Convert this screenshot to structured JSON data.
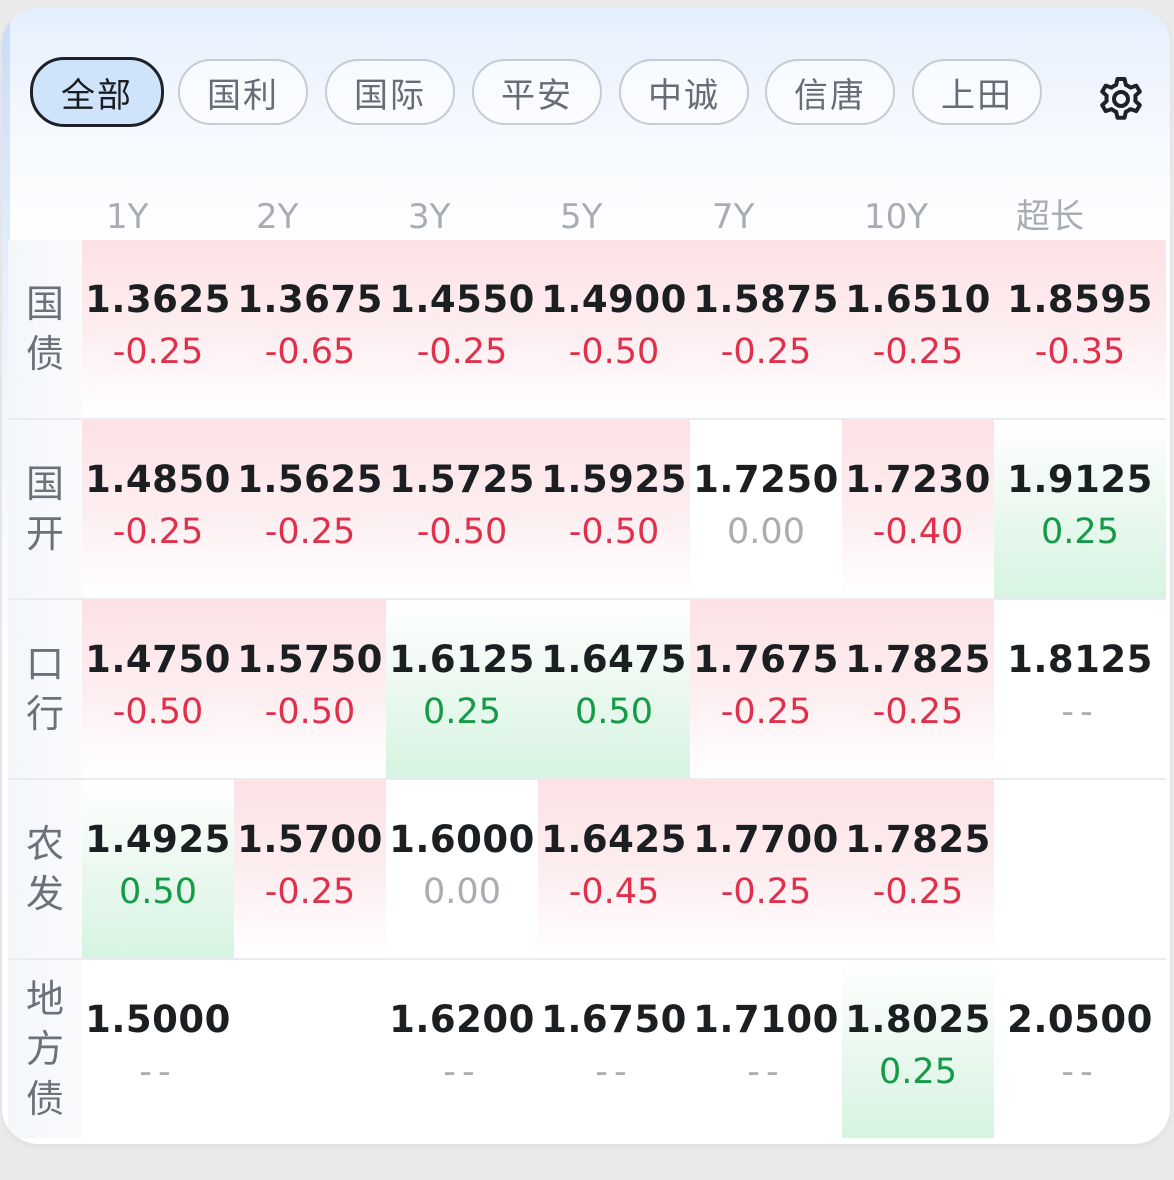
{
  "tabs": [
    "全部",
    "国利",
    "国际",
    "平安",
    "中诚",
    "信唐",
    "上田"
  ],
  "active_tab": 0,
  "settings_icon": "gear-icon",
  "columns": [
    "1Y",
    "2Y",
    "3Y",
    "5Y",
    "7Y",
    "10Y",
    "超长"
  ],
  "colors": {
    "up_text": "#e0304c",
    "down_text": "#159a48",
    "neutral_text": "#a9adb2"
  },
  "rows": [
    {
      "label": [
        "国",
        "债"
      ],
      "cells": [
        {
          "rate": "1.3625",
          "change": "-0.25",
          "dir": "up"
        },
        {
          "rate": "1.3675",
          "change": "-0.65",
          "dir": "up"
        },
        {
          "rate": "1.4550",
          "change": "-0.25",
          "dir": "up"
        },
        {
          "rate": "1.4900",
          "change": "-0.50",
          "dir": "up"
        },
        {
          "rate": "1.5875",
          "change": "-0.25",
          "dir": "up"
        },
        {
          "rate": "1.6510",
          "change": "-0.25",
          "dir": "up"
        },
        {
          "rate": "1.8595",
          "change": "-0.35",
          "dir": "up"
        }
      ]
    },
    {
      "label": [
        "国",
        "开"
      ],
      "cells": [
        {
          "rate": "1.4850",
          "change": "-0.25",
          "dir": "up"
        },
        {
          "rate": "1.5625",
          "change": "-0.25",
          "dir": "up"
        },
        {
          "rate": "1.5725",
          "change": "-0.50",
          "dir": "up"
        },
        {
          "rate": "1.5925",
          "change": "-0.50",
          "dir": "up"
        },
        {
          "rate": "1.7250",
          "change": "0.00",
          "dir": "zero"
        },
        {
          "rate": "1.7230",
          "change": "-0.40",
          "dir": "up"
        },
        {
          "rate": "1.9125",
          "change": "0.25",
          "dir": "down"
        }
      ]
    },
    {
      "label": [
        "口",
        "行"
      ],
      "cells": [
        {
          "rate": "1.4750",
          "change": "-0.50",
          "dir": "up"
        },
        {
          "rate": "1.5750",
          "change": "-0.50",
          "dir": "up"
        },
        {
          "rate": "1.6125",
          "change": "0.25",
          "dir": "down"
        },
        {
          "rate": "1.6475",
          "change": "0.50",
          "dir": "down"
        },
        {
          "rate": "1.7675",
          "change": "-0.25",
          "dir": "up"
        },
        {
          "rate": "1.7825",
          "change": "-0.25",
          "dir": "up"
        },
        {
          "rate": "1.8125",
          "change": "--",
          "dir": "none"
        }
      ]
    },
    {
      "label": [
        "农",
        "发"
      ],
      "cells": [
        {
          "rate": "1.4925",
          "change": "0.50",
          "dir": "down"
        },
        {
          "rate": "1.5700",
          "change": "-0.25",
          "dir": "up"
        },
        {
          "rate": "1.6000",
          "change": "0.00",
          "dir": "zero"
        },
        {
          "rate": "1.6425",
          "change": "-0.45",
          "dir": "up"
        },
        {
          "rate": "1.7700",
          "change": "-0.25",
          "dir": "up"
        },
        {
          "rate": "1.7825",
          "change": "-0.25",
          "dir": "up"
        },
        {
          "rate": "",
          "change": "",
          "dir": "empty"
        }
      ]
    },
    {
      "label": [
        "地",
        "方",
        "债"
      ],
      "cells": [
        {
          "rate": "1.5000",
          "change": "--",
          "dir": "none"
        },
        {
          "rate": "",
          "change": "",
          "dir": "empty"
        },
        {
          "rate": "1.6200",
          "change": "--",
          "dir": "none"
        },
        {
          "rate": "1.6750",
          "change": "--",
          "dir": "none"
        },
        {
          "rate": "1.7100",
          "change": "--",
          "dir": "none"
        },
        {
          "rate": "1.8025",
          "change": "0.25",
          "dir": "down"
        },
        {
          "rate": "2.0500",
          "change": "--",
          "dir": "none"
        }
      ]
    }
  ]
}
